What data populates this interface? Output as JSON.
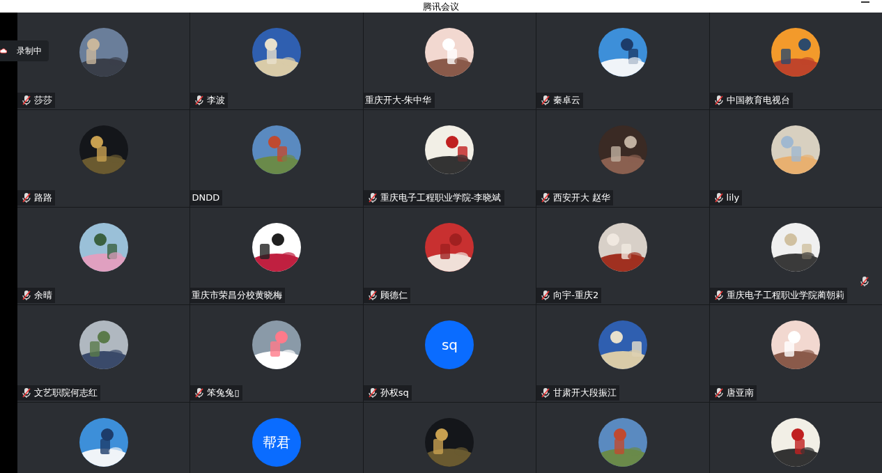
{
  "window": {
    "title": "腾讯会议"
  },
  "recording": {
    "label": "录制中"
  },
  "participants": [
    {
      "name": "莎莎",
      "muted": true,
      "avatar": {
        "kind": "picture"
      }
    },
    {
      "name": "李波",
      "muted": true,
      "avatar": {
        "kind": "picture"
      }
    },
    {
      "name": "重庆开大-朱中华",
      "muted": false,
      "avatar": {
        "kind": "picture"
      }
    },
    {
      "name": "秦卓云",
      "muted": true,
      "avatar": {
        "kind": "picture"
      }
    },
    {
      "name": "中国教育电视台",
      "muted": true,
      "avatar": {
        "kind": "picture"
      }
    },
    {
      "name": "路路",
      "muted": true,
      "avatar": {
        "kind": "picture"
      }
    },
    {
      "name": "DNDD",
      "muted": false,
      "avatar": {
        "kind": "picture"
      }
    },
    {
      "name": "重庆电子工程职业学院-李晓斌",
      "muted": true,
      "avatar": {
        "kind": "picture"
      }
    },
    {
      "name": "西安开大 赵华",
      "muted": true,
      "avatar": {
        "kind": "picture"
      }
    },
    {
      "name": "lily",
      "muted": true,
      "avatar": {
        "kind": "picture"
      }
    },
    {
      "name": "余晴",
      "muted": true,
      "avatar": {
        "kind": "picture"
      }
    },
    {
      "name": "重庆市荣昌分校黄晓梅",
      "muted": false,
      "avatar": {
        "kind": "picture"
      }
    },
    {
      "name": "顾德仁",
      "muted": true,
      "avatar": {
        "kind": "picture"
      }
    },
    {
      "name": "向宇-重庆2",
      "muted": true,
      "avatar": {
        "kind": "picture"
      }
    },
    {
      "name": "重庆电子工程职业学院蔺朝莉",
      "muted": true,
      "avatar": {
        "kind": "picture"
      }
    },
    {
      "name": "文艺职院何志红",
      "muted": true,
      "avatar": {
        "kind": "picture"
      }
    },
    {
      "name": "笨兔兔▯",
      "muted": true,
      "avatar": {
        "kind": "picture"
      }
    },
    {
      "name": "孙权sq",
      "muted": true,
      "avatar": {
        "kind": "text",
        "text": "sq",
        "color": "#0a6cff"
      }
    },
    {
      "name": "甘肃开大段振江",
      "muted": true,
      "avatar": {
        "kind": "picture"
      }
    },
    {
      "name": "唐亚南",
      "muted": true,
      "avatar": {
        "kind": "picture"
      }
    },
    {
      "avatar": {
        "kind": "picture"
      }
    },
    {
      "avatar": {
        "kind": "text",
        "text": "帮君",
        "color": "#0a6cff"
      }
    },
    {
      "avatar": {
        "kind": "picture"
      }
    },
    {
      "avatar": {
        "kind": "picture"
      }
    },
    {
      "avatar": {
        "kind": "picture"
      }
    }
  ]
}
